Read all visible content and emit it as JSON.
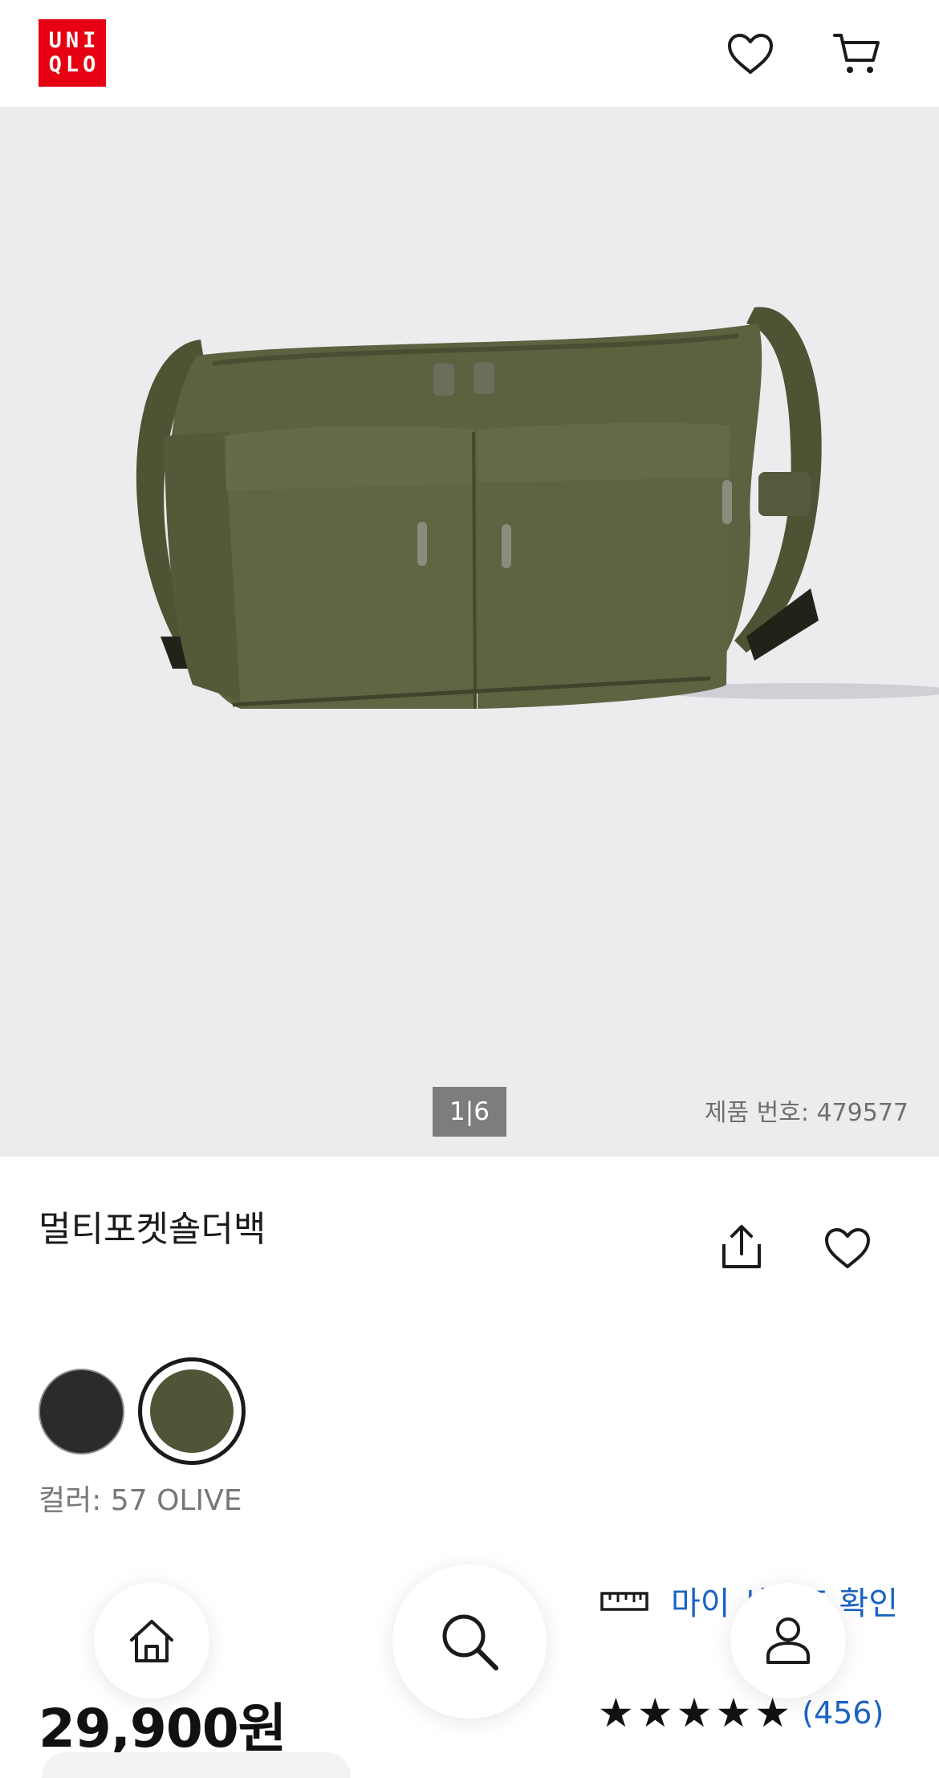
{
  "header": {
    "logo_line1": "UNI",
    "logo_line2": "QLO",
    "icons": [
      "heart-icon",
      "cart-icon"
    ]
  },
  "gallery": {
    "counter": "1|6",
    "product_number": "제품 번호: 479577"
  },
  "product": {
    "title": "멀티포켓숄더백",
    "actions": [
      "share-icon",
      "heart-icon"
    ],
    "colors": [
      {
        "name": "black",
        "hex": "#2a2b2d",
        "selected": false
      },
      {
        "name": "olive",
        "hex": "#4f5638",
        "selected": true
      }
    ],
    "color_label": "컬러: 57 OLIVE",
    "size_link": "마이 사이즈 확인",
    "price": "29,900원",
    "rating": {
      "stars": "★★★★★",
      "value": 5,
      "count": "(456)"
    }
  },
  "bottom_nav": [
    "home-icon",
    "search-icon",
    "profile-icon"
  ],
  "colors": {
    "brand": "#e60012",
    "link": "#1a63c2",
    "hero_bg": "#ebecee"
  }
}
